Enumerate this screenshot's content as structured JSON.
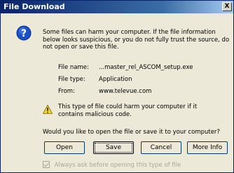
{
  "window": {
    "title": "File Download",
    "close_label": "X"
  },
  "message": {
    "warning": "Some files can harm your computer. If the file information below looks suspicious, or you do not fully trust the source, do not open or save this file."
  },
  "file_info": {
    "name_label": "File name:",
    "name_value": "...master_rel_ASCOM_setup.exe",
    "type_label": "File type:",
    "type_value": "Application",
    "from_label": "From:",
    "from_value": "www.televue.com"
  },
  "alert": {
    "text": "This type of file could harm your computer if it contains malicious code."
  },
  "question": "Would you like to open the file or save it to your computer?",
  "buttons": {
    "open": "Open",
    "save": "Save",
    "cancel": "Cancel",
    "more_info": "More Info"
  },
  "checkbox": {
    "label": "Always ask before opening this type of file",
    "checked": true,
    "enabled": false
  }
}
